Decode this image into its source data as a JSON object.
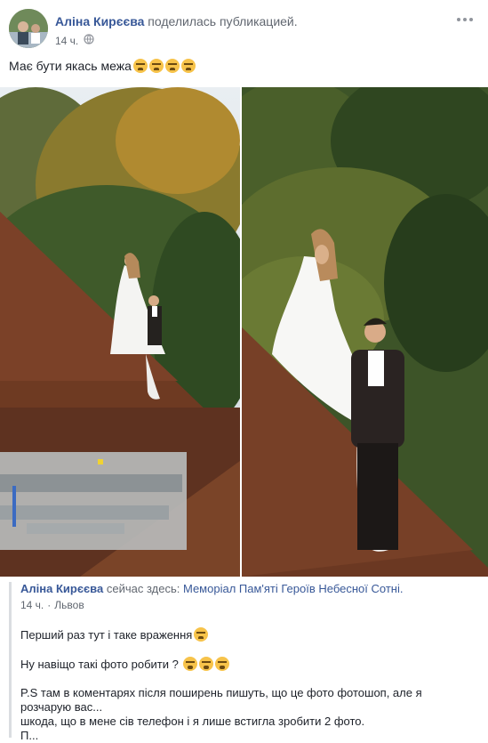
{
  "post": {
    "author": "Аліна Кирєєва",
    "action": "поделилась публикацией.",
    "time": "14 ч.",
    "text": "Має бути якась межа"
  },
  "shared": {
    "author": "Аліна Кирєєва",
    "status_prefix": "сейчас здесь:",
    "place": "Меморіал Пам'яті Героїв Небесної Сотні.",
    "time": "14 ч.",
    "separator": "·",
    "location": "Львов",
    "lines": [
      "Перший раз тут і таке враження",
      "Ну навіщо такі фото робити ?",
      "P.S там в коментарях після поширень пишуть, що це фото фотошоп, але я",
      "розчарую вас...",
      "шкода, що в мене сів телефон і я лише встигла зробити 2 фото.",
      "П..."
    ]
  },
  "icons": {
    "more": "more-options-icon",
    "globe": "globe-icon",
    "emoji": "weary-face-emoji"
  },
  "colors": {
    "link": "#385898",
    "muted": "#606770",
    "text": "#1d2129"
  }
}
